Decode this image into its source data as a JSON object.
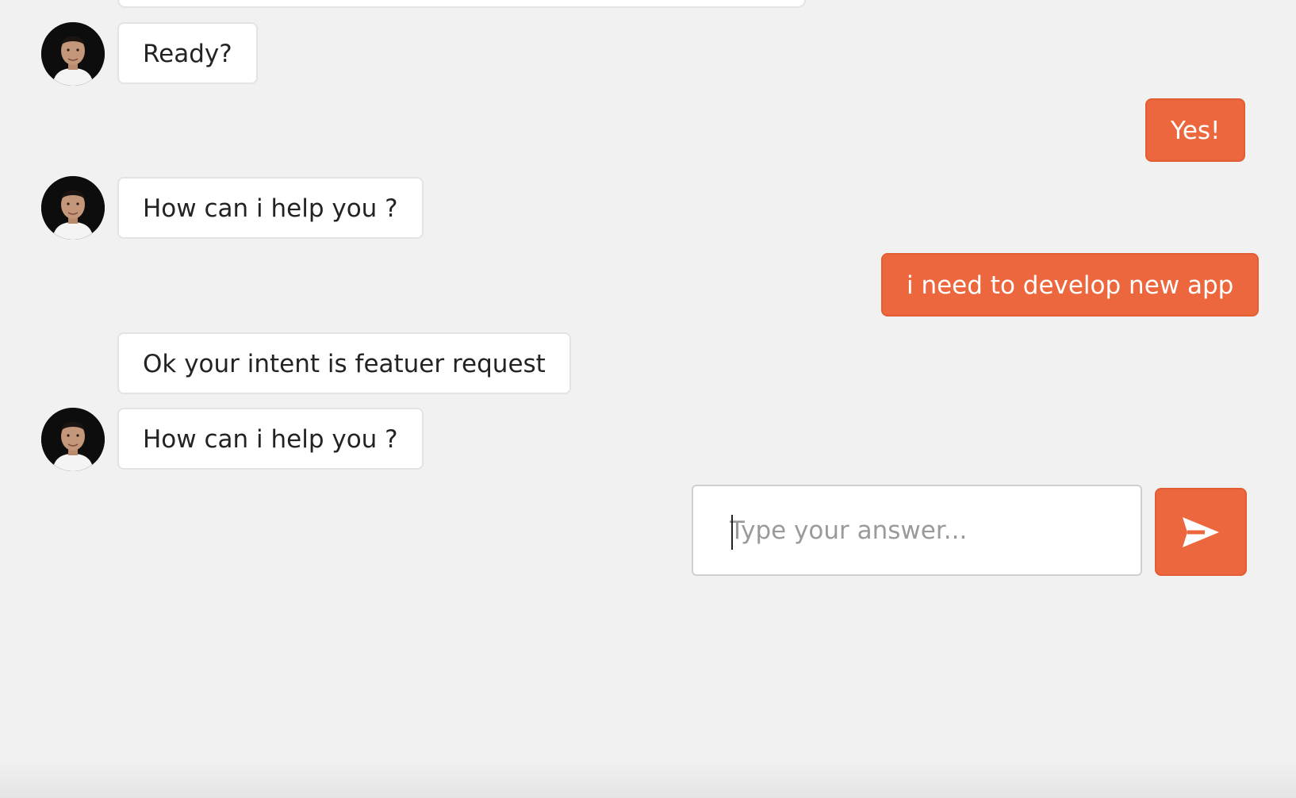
{
  "colors": {
    "background": "#f1f1f1",
    "bot_bubble": "#ffffff",
    "user_bubble": "#ec673d",
    "user_text": "#ffffff",
    "bot_text": "#232323"
  },
  "messages": [
    {
      "sender": "bot",
      "text": "Ready?",
      "avatar": true
    },
    {
      "sender": "user",
      "text": "Yes!"
    },
    {
      "sender": "bot",
      "text": "How can i help you ?",
      "avatar": true
    },
    {
      "sender": "user",
      "text": "i need to develop new app"
    },
    {
      "sender": "bot",
      "text": "Ok your intent is featuer request",
      "avatar": false
    },
    {
      "sender": "bot",
      "text": "How can i help you ?",
      "avatar": true
    }
  ],
  "composer": {
    "placeholder": "Type your answer...",
    "value": "",
    "send_icon": "send-arrow-icon"
  }
}
